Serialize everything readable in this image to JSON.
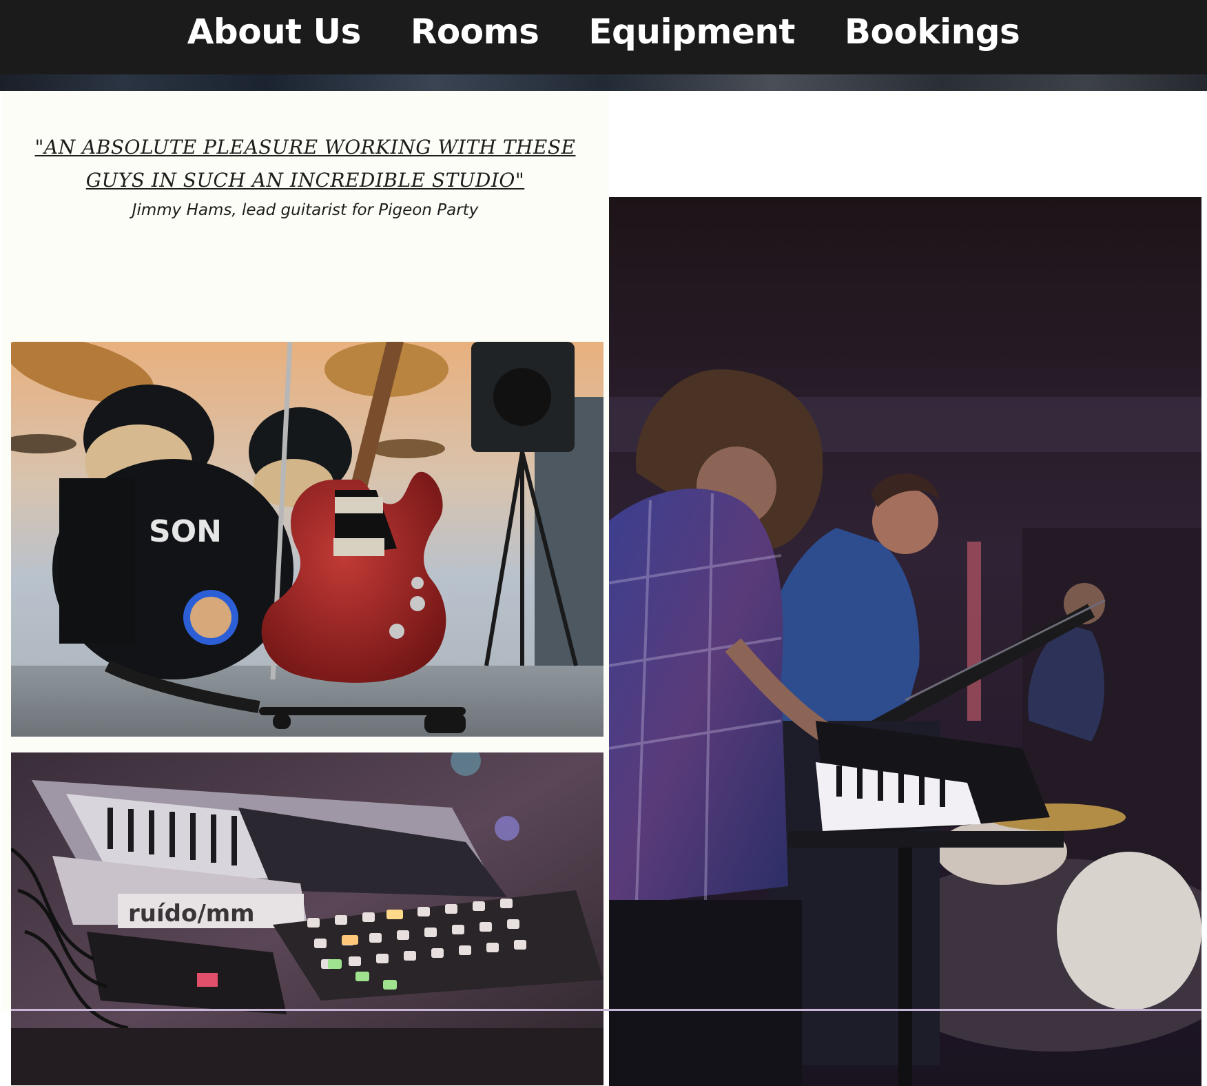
{
  "nav": {
    "items": [
      {
        "label": "About Us"
      },
      {
        "label": "Rooms"
      },
      {
        "label": "Equipment"
      },
      {
        "label": "Bookings"
      }
    ]
  },
  "testimonial": {
    "quote": "\"An absolute pleasure working with these guys in such an incredible studio\"",
    "attribution": "Jimmy Hams, lead guitarist for Pigeon Party"
  },
  "photos": {
    "keys_label": "ruído/mm"
  },
  "colors": {
    "nav_background": "#1b1b1b",
    "nav_text": "#ffffff",
    "panel_background": "#fdfdf7",
    "accent_rule": "#c7b6d6"
  }
}
